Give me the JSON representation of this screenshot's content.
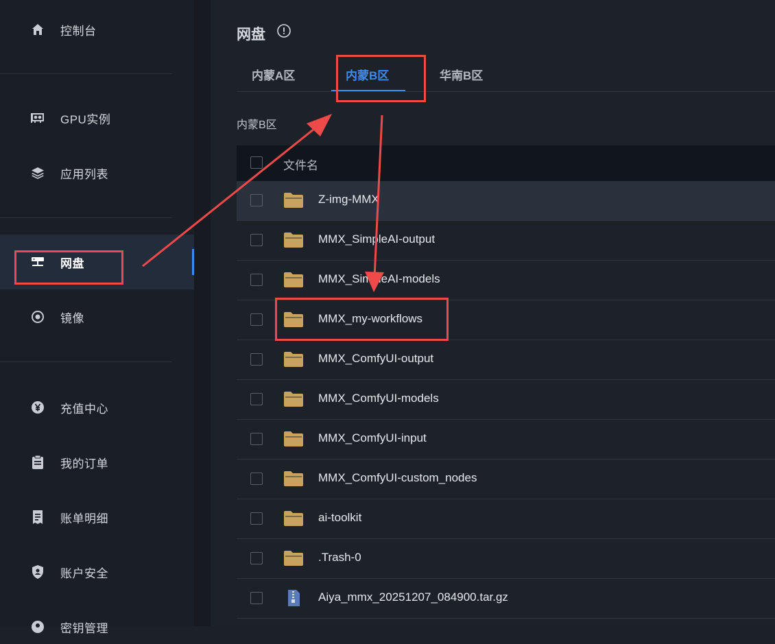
{
  "sidebar": {
    "items": [
      {
        "label": "控制台",
        "icon": "home-icon"
      },
      {
        "label": "GPU实例",
        "icon": "gpu-icon"
      },
      {
        "label": "应用列表",
        "icon": "layers-icon"
      },
      {
        "label": "网盘",
        "icon": "network-disk-icon"
      },
      {
        "label": "镜像",
        "icon": "disc-icon"
      },
      {
        "label": "充值中心",
        "icon": "yen-icon"
      },
      {
        "label": "我的订单",
        "icon": "clipboard-icon"
      },
      {
        "label": "账单明细",
        "icon": "receipt-icon"
      },
      {
        "label": "账户安全",
        "icon": "shield-icon"
      },
      {
        "label": "密钥管理",
        "icon": "key-icon"
      }
    ]
  },
  "page": {
    "title": "网盘",
    "tabs": [
      "内蒙A区",
      "内蒙B区",
      "华南B区"
    ],
    "active_tab": "内蒙B区",
    "section_label": "内蒙B区"
  },
  "table": {
    "header": "文件名",
    "rows": [
      {
        "name": "Z-img-MMX",
        "type": "folder"
      },
      {
        "name": "MMX_SimpleAI-output",
        "type": "folder"
      },
      {
        "name": "MMX_SimpleAI-models",
        "type": "folder"
      },
      {
        "name": "MMX_my-workflows",
        "type": "folder"
      },
      {
        "name": "MMX_ComfyUI-output",
        "type": "folder"
      },
      {
        "name": "MMX_ComfyUI-models",
        "type": "folder"
      },
      {
        "name": "MMX_ComfyUI-input",
        "type": "folder"
      },
      {
        "name": "MMX_ComfyUI-custom_nodes",
        "type": "folder"
      },
      {
        "name": "ai-toolkit",
        "type": "folder"
      },
      {
        "name": ".Trash-0",
        "type": "folder"
      },
      {
        "name": "Aiya_mmx_20251207_084900.tar.gz",
        "type": "archive"
      }
    ]
  },
  "colors": {
    "accent": "#3d8bf2",
    "annotation": "#ef4a4a",
    "folder": "#c9a35d"
  }
}
